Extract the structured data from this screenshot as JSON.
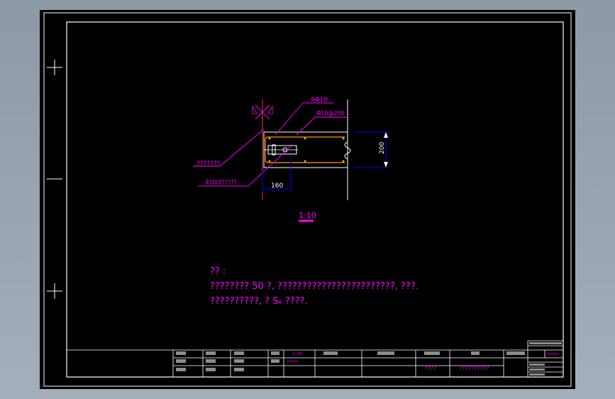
{
  "colors": {
    "background": "#000000",
    "frame": "#ffffff",
    "annotation": "#ff00ff",
    "dimension": "#0000ff",
    "rebar": "#ff9900",
    "dim_text": "#ffffff",
    "title_text": "#ff00ff"
  },
  "detail": {
    "label_rebar_top": "9Φ10",
    "label_stirrup": "Φ10@200",
    "label_left_a": "???????",
    "label_left_b": "EJ320?????",
    "dim_height": "200",
    "dim_width": "160",
    "scale": "1:10"
  },
  "notes": {
    "line1": "?? :",
    "line2": "????????  50  ?,  ????????????????????????, ???.",
    "line3": "??????????, ?  S₆  ????."
  },
  "title_block": {
    "cell_1": "1:10",
    "cell_2": "?????",
    "cell_3": "????",
    "cell_4": "??????????",
    "cell_5": "???????"
  }
}
